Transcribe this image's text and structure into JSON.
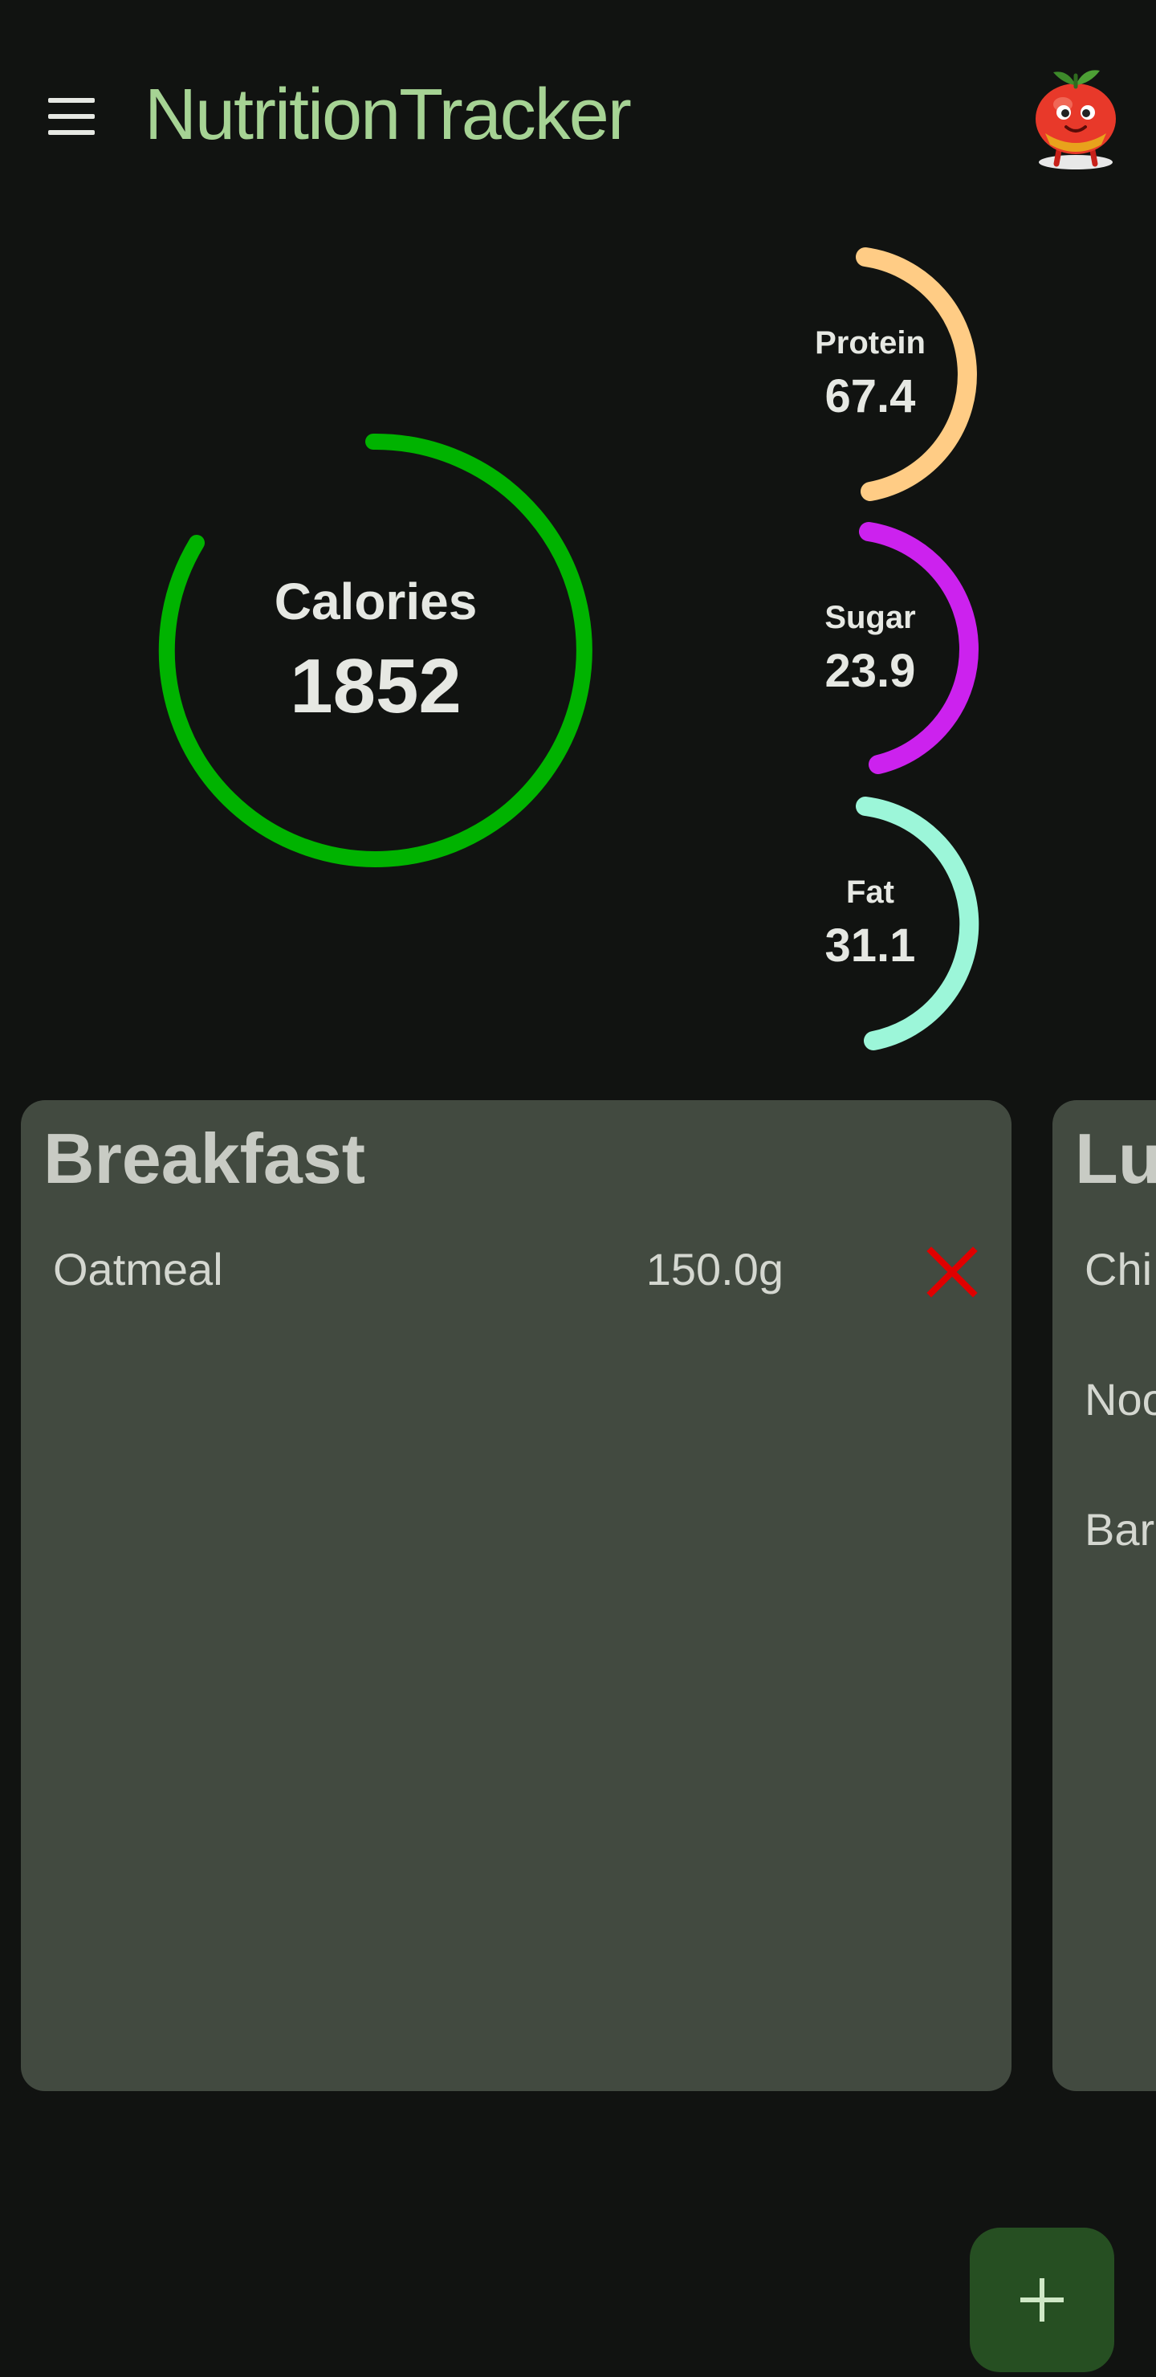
{
  "app": {
    "title": "NutritionTracker",
    "accent_color": "#a6d394",
    "menu_icon": "hamburger-menu-icon",
    "avatar_icon": "tomato-mascot-icon"
  },
  "summary": {
    "calories": {
      "label": "Calories",
      "value": "1852",
      "color": "#00b300"
    },
    "macros": [
      {
        "label": "Protein",
        "value": "67.4",
        "color": "#ffcc85"
      },
      {
        "label": "Sugar",
        "value": "23.9",
        "color": "#cc22ee"
      },
      {
        "label": "Fat",
        "value": "31.1",
        "color": "#9cf6d9"
      }
    ]
  },
  "meals": [
    {
      "title": "Breakfast",
      "items": [
        {
          "name": "Oatmeal",
          "qty": "150.0g"
        }
      ]
    },
    {
      "title": "Lu",
      "items": [
        {
          "name": "Chi"
        },
        {
          "name": "Noo"
        },
        {
          "name": "Bar"
        }
      ]
    }
  ],
  "actions": {
    "delete_icon": "close-x-icon",
    "delete_color": "#e00000",
    "add_icon": "plus-icon"
  }
}
